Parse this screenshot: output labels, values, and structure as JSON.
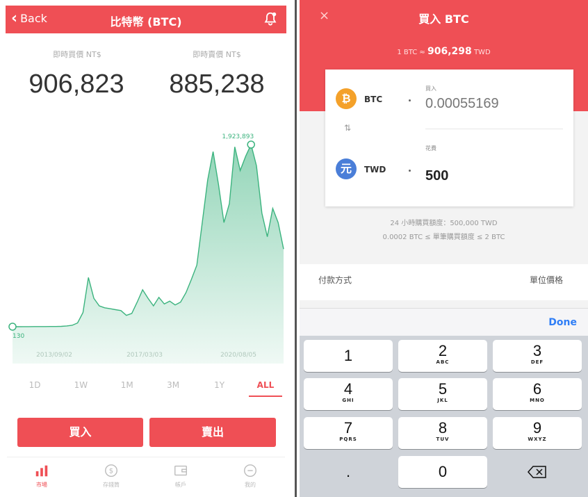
{
  "left": {
    "header": {
      "back": "Back",
      "title": "比特幣 (BTC)"
    },
    "prices": [
      {
        "label": "即時買價 NT$",
        "value": "906,823"
      },
      {
        "label": "即時賣價 NT$",
        "value": "885,238"
      }
    ],
    "chart_data": {
      "type": "area",
      "color": "#3bb37e",
      "x_ticks": [
        "2013/09/02",
        "2017/03/03",
        "2020/08/05"
      ],
      "max_label": "1,923,893",
      "min_label": "130",
      "series": [
        {
          "values": [
            130,
            130,
            400,
            700,
            1200,
            1500,
            1800,
            2000,
            2500,
            4000,
            8000,
            15000,
            40000,
            150000,
            520000,
            300000,
            220000,
            200000,
            190000,
            180000,
            170000,
            120000,
            140000,
            260000,
            390000,
            300000,
            220000,
            310000,
            240000,
            270000,
            230000,
            260000,
            360000,
            500000,
            650000,
            1100000,
            1550000,
            1850000,
            1500000,
            1100000,
            1300000,
            1900000,
            1650000,
            1800000,
            1923893,
            1700000,
            1200000,
            950000,
            1250000,
            1100000,
            820000
          ]
        }
      ]
    },
    "ranges": [
      "1D",
      "1W",
      "1M",
      "3M",
      "1Y",
      "ALL"
    ],
    "active_range": "ALL",
    "buttons": {
      "buy": "買入",
      "sell": "賣出"
    },
    "tabs": [
      "市場",
      "存錢筒",
      "帳戶",
      "我的"
    ]
  },
  "right": {
    "header": {
      "close": "×",
      "title": "買入 BTC"
    },
    "rate": {
      "prefix": "1 BTC ≈ ",
      "value": "906,298",
      "suffix": " TWD"
    },
    "btc": {
      "code": "BTC",
      "label": "買入",
      "value": "0.00055169"
    },
    "twd": {
      "code": "TWD",
      "label": "花費",
      "value": "500"
    },
    "limits": [
      "24 小時購買額度：500,000 TWD",
      "0.0002 BTC ≤ 單筆購買額度 ≤ 2 BTC"
    ],
    "pay_method": "付款方式",
    "unit_price": "單位價格",
    "done": "Done",
    "keys": [
      {
        "n": "1",
        "s": ""
      },
      {
        "n": "2",
        "s": "ABC"
      },
      {
        "n": "3",
        "s": "DEF"
      },
      {
        "n": "4",
        "s": "GHI"
      },
      {
        "n": "5",
        "s": "JKL"
      },
      {
        "n": "6",
        "s": "MNO"
      },
      {
        "n": "7",
        "s": "PQRS"
      },
      {
        "n": "8",
        "s": "TUV"
      },
      {
        "n": "9",
        "s": "WXYZ"
      },
      {
        "n": ".",
        "s": ""
      },
      {
        "n": "0",
        "s": ""
      }
    ]
  }
}
